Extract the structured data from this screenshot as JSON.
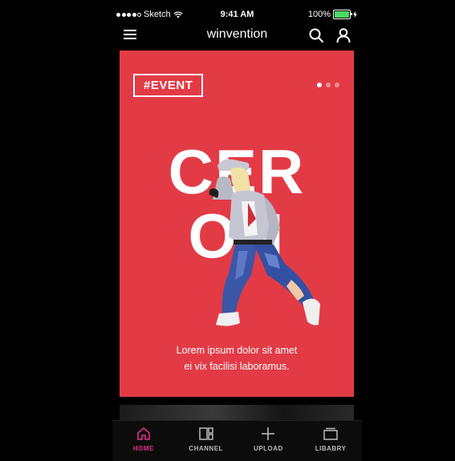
{
  "status_bar": {
    "carrier": "Sketch",
    "time": "9:41 AM",
    "battery": "100%",
    "battery_level": 1.0
  },
  "nav": {
    "title": "winvention"
  },
  "card": {
    "tag": "#EVENT",
    "headline_line1": "CER",
    "headline_line2": "ON",
    "caption_line1": "Lorem ipsum dolor sit amet",
    "caption_line2": "ei vix facilisi laboramus.",
    "pager": {
      "count": 3,
      "active": 1
    }
  },
  "tabs": [
    {
      "label": "HOME",
      "icon": "home-icon",
      "active": true
    },
    {
      "label": "CHANNEL",
      "icon": "channel-icon",
      "active": false
    },
    {
      "label": "UPLOAD",
      "icon": "plus-icon",
      "active": false
    },
    {
      "label": "LIBABRY",
      "icon": "library-icon",
      "active": false
    }
  ],
  "colors": {
    "card_bg": "#e23b46",
    "accent": "#e0308a",
    "battery": "#4cd964"
  }
}
